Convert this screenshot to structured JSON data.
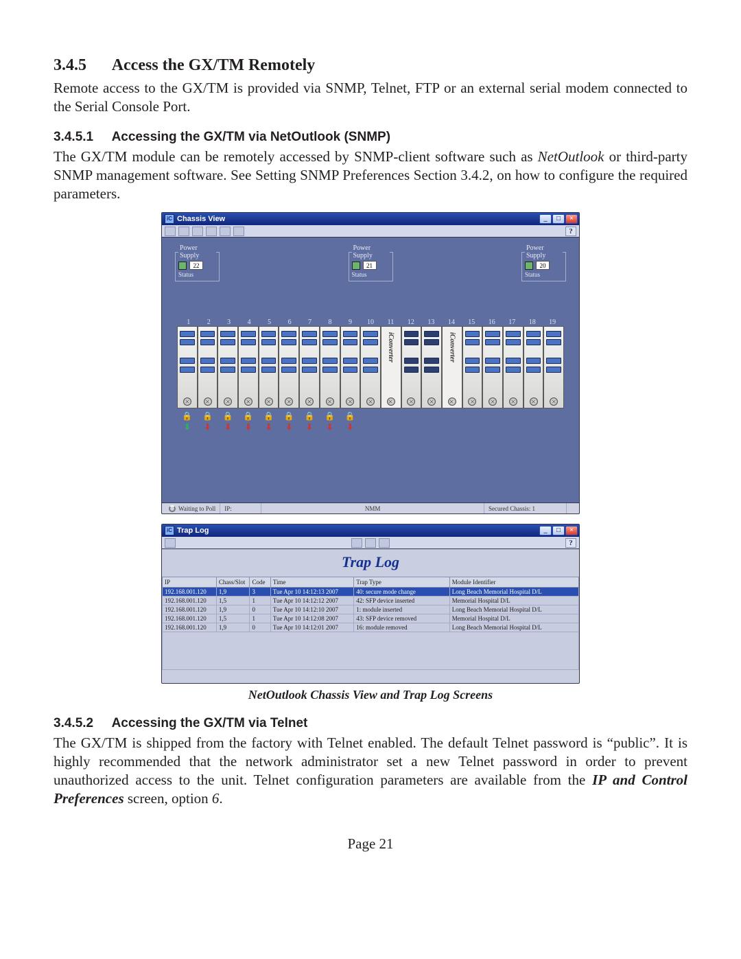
{
  "section": {
    "num": "3.4.5",
    "title": "Access the GX/TM Remotely",
    "intro": "Remote access to the GX/TM is provided via SNMP, Telnet, FTP or an external serial modem connected to the Serial Console Port."
  },
  "sub1": {
    "num": "3.4.5.1",
    "title": "Accessing the GX/TM via NetOutlook (SNMP)",
    "para_a": "The GX/TM module can be remotely accessed by SNMP-client software such as ",
    "kw": "NetOutlook",
    "para_b": " or third-party SNMP management software.  See Setting SNMP Preferences Section 3.4.2, on how to configure the required parameters."
  },
  "chassis": {
    "title": "Chassis View",
    "help": "?",
    "ps_legend": "Power Supply",
    "ps_status": "Status",
    "ps_ids": [
      "22",
      "21",
      "20"
    ],
    "slot_nums": [
      "1",
      "2",
      "3",
      "4",
      "5",
      "6",
      "7",
      "8",
      "9",
      "10",
      "11",
      "12",
      "13",
      "14",
      "15",
      "16",
      "17",
      "18",
      "19"
    ],
    "iconverter": "iConverter",
    "status_wait": "Waiting to Poll",
    "status_ip": "IP:",
    "status_nmm": "NMM",
    "status_secure": "Secured Chassis: 1"
  },
  "trap": {
    "title": "Trap Log",
    "big_title": "Trap Log",
    "help": "?",
    "cols": [
      "IP",
      "Chass/Slot",
      "Code",
      "Time",
      "Trap Type",
      "Module Identifier"
    ],
    "rows": [
      {
        "ip": "192.168.001.120",
        "cs": "1,9",
        "code": "3",
        "time": "Tue Apr 10 14:12:13 2007",
        "type": "40: secure mode change",
        "id": "Long Beach Memorial Hospital D/L",
        "sel": true
      },
      {
        "ip": "192.168.001.120",
        "cs": "1,5",
        "code": "1",
        "time": "Tue Apr 10 14:12:12 2007",
        "type": "42: SFP device inserted",
        "id": "Memorial Hospital D/L"
      },
      {
        "ip": "192.168.001.120",
        "cs": "1,9",
        "code": "0",
        "time": "Tue Apr 10 14:12:10 2007",
        "type": "1: module inserted",
        "id": "Long Beach Memorial Hospital D/L"
      },
      {
        "ip": "192.168.001.120",
        "cs": "1,5",
        "code": "1",
        "time": "Tue Apr 10 14:12:08 2007",
        "type": "43: SFP device removed",
        "id": "Memorial Hospital D/L"
      },
      {
        "ip": "192.168.001.120",
        "cs": "1,9",
        "code": "0",
        "time": "Tue Apr 10 14:12:01 2007",
        "type": "16: module removed",
        "id": "Long Beach Memorial Hospital D/L"
      }
    ]
  },
  "caption": "NetOutlook Chassis View and Trap Log Screens",
  "sub2": {
    "num": "3.4.5.2",
    "title": "Accessing the GX/TM via Telnet",
    "para_a": "The GX/TM is shipped from the factory with Telnet enabled.  The default Telnet password is “public”.  It is highly recommended that the network administrator set a new Telnet password in order to prevent unauthorized access to the unit.  Telnet configuration parameters are available from the ",
    "kw": "IP and Control Preferences",
    "para_b": " screen, option ",
    "opt": "6",
    "para_c": "."
  },
  "page": "Page 21"
}
